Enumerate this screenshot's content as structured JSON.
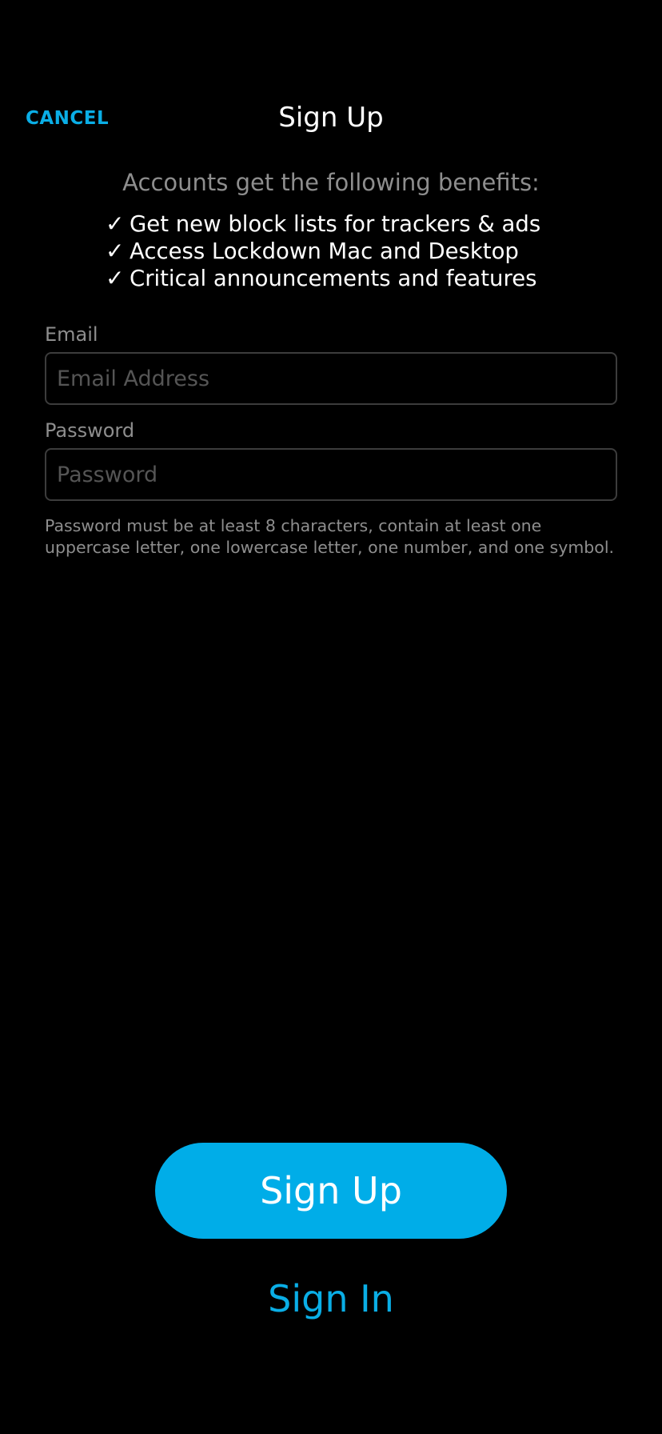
{
  "nav": {
    "cancel_label": "CANCEL",
    "title": "Sign Up"
  },
  "benefits": {
    "heading": "Accounts get the following benefits:",
    "check_icon": "checkmark-icon",
    "items": [
      {
        "label": "Get new block lists for trackers & ads"
      },
      {
        "label": "Access Lockdown Mac and Desktop"
      },
      {
        "label": "Critical announcements and features"
      }
    ]
  },
  "form": {
    "email": {
      "label": "Email",
      "placeholder": "Email Address",
      "value": ""
    },
    "password": {
      "label": "Password",
      "placeholder": "Password",
      "value": ""
    },
    "password_hint": "Password must be at least 8 characters, contain at least one uppercase letter, one lowercase letter, one number, and one symbol."
  },
  "actions": {
    "signup_label": "Sign Up",
    "signin_label": "Sign In"
  },
  "colors": {
    "accent": "#00ade8",
    "background": "#000000",
    "muted_text": "#8e8e8e",
    "field_border": "#3c3c3c"
  }
}
